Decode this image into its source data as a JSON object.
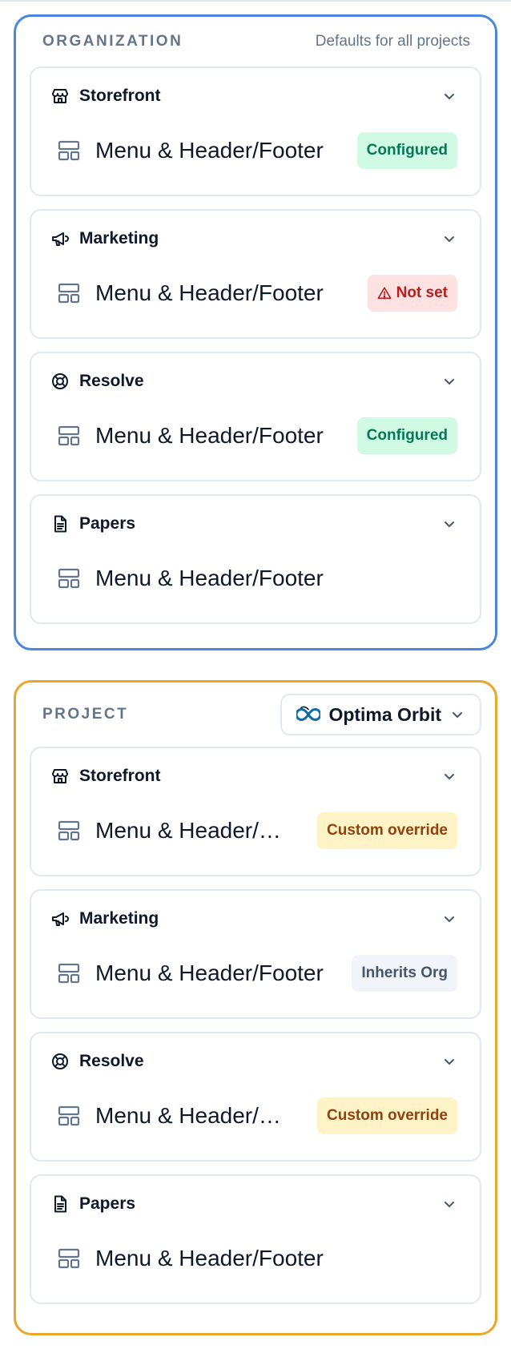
{
  "organization": {
    "title": "ORGANIZATION",
    "note": "Defaults for all projects",
    "accent": "#4a86df",
    "cards": [
      {
        "title": "Storefront",
        "icon": "store-icon",
        "item": "Menu & Header/Footer",
        "badge": "Configured",
        "badge_type": "configured"
      },
      {
        "title": "Marketing",
        "icon": "megaphone-icon",
        "item": "Menu & Header/Footer",
        "badge": "Not set",
        "badge_type": "notset"
      },
      {
        "title": "Resolve",
        "icon": "lifebuoy-icon",
        "item": "Menu & Header/Footer",
        "badge": "Configured",
        "badge_type": "configured"
      },
      {
        "title": "Papers",
        "icon": "document-icon",
        "item": "Menu & Header/Footer",
        "badge": "",
        "badge_type": "none"
      }
    ]
  },
  "project": {
    "title": "PROJECT",
    "accent": "#eca52b",
    "selector": {
      "name": "Optima Orbit",
      "icon": "infinity-logo-icon"
    },
    "cards": [
      {
        "title": "Storefront",
        "icon": "store-icon",
        "item": "Menu & Header/Footer",
        "item_display": "Menu & Header/…",
        "badge": "Custom override",
        "badge_type": "override"
      },
      {
        "title": "Marketing",
        "icon": "megaphone-icon",
        "item": "Menu & Header/Footer",
        "item_display": "Menu & Header/Footer",
        "badge": "Inherits Org",
        "badge_type": "inherits"
      },
      {
        "title": "Resolve",
        "icon": "lifebuoy-icon",
        "item": "Menu & Header/Footer",
        "item_display": "Menu & Header/…",
        "badge": "Custom override",
        "badge_type": "override"
      },
      {
        "title": "Papers",
        "icon": "document-icon",
        "item": "Menu & Header/Footer",
        "item_display": "Menu & Header/Footer",
        "badge": "",
        "badge_type": "none"
      }
    ]
  },
  "colors": {
    "configured_bg": "#d1fae5",
    "configured_fg": "#047857",
    "notset_bg": "#fee2e2",
    "notset_fg": "#b91c1c",
    "override_bg": "#fef3c7",
    "override_fg": "#92400e",
    "inherits_bg": "#f1f5f9",
    "inherits_fg": "#475569"
  }
}
